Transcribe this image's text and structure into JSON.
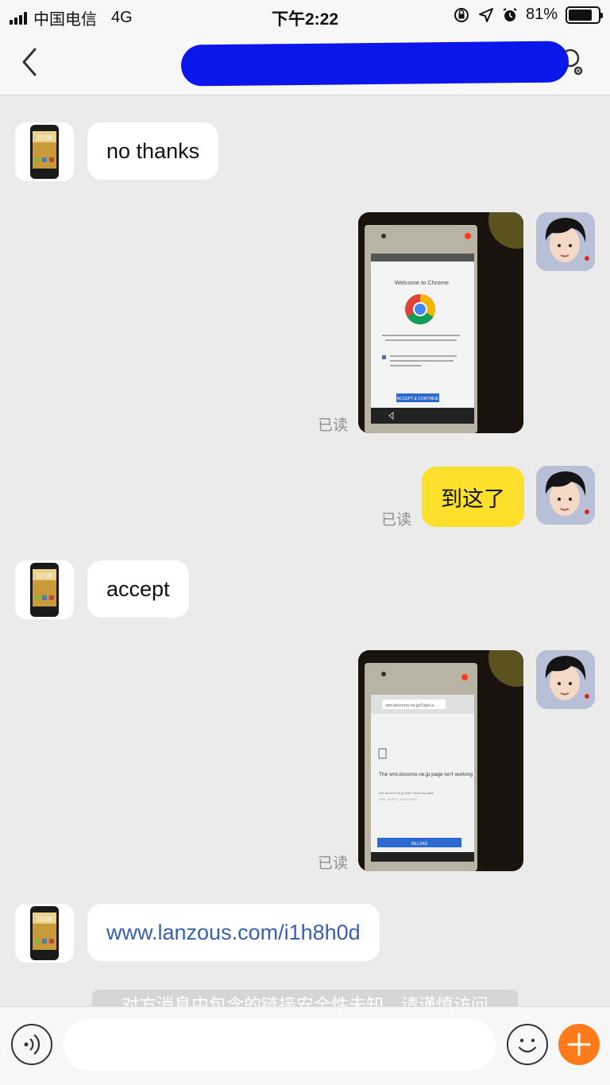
{
  "status_bar": {
    "carrier": "中国电信",
    "network": "4G",
    "time": "下午2:22",
    "battery": "81%",
    "battery_level": 0.81
  },
  "nav": {
    "back_icon": "chevron-left-icon",
    "search_icon": "search-settings-icon"
  },
  "messages": [
    {
      "side": "left",
      "type": "text",
      "text": "no thanks"
    },
    {
      "side": "right",
      "type": "image",
      "status": "已读",
      "image": {
        "screen_title": "Welcome to Chrome",
        "terms_text": "By using this application, you agree to Chrome's Terms of Service and Privacy Notice.",
        "checkbox_text": "Help make Chrome better by sending usage statistics and crash reports to Google.",
        "button": "ACCEPT & CONTINUE"
      }
    },
    {
      "side": "right",
      "type": "text",
      "text": "到这了",
      "status": "已读"
    },
    {
      "side": "left",
      "type": "text",
      "text": "accept"
    },
    {
      "side": "right",
      "type": "image",
      "status": "已读",
      "image": {
        "url_bar": "smt.docomo.ne.jp/Start.a",
        "error_title": "The smt.docomo.ne.jp page isn't working",
        "error_detail": "smt.docomo.ne.jp didn't send any data.",
        "error_code": "ERR_EMPTY_RESPONSE",
        "button": "RELOAD"
      }
    },
    {
      "side": "left",
      "type": "link",
      "text": "www.lanzous.com/i1h8h0d"
    }
  ],
  "notice": "对方消息中包含的链接安全性未知，请谨慎访问",
  "input_bar": {
    "placeholder": "",
    "voice_icon": "voice-icon",
    "emoji_icon": "emoji-icon",
    "plus_icon": "plus-icon"
  },
  "colors": {
    "background": "#ebebeb",
    "own_bubble": "#fde02b",
    "link": "#3760ad",
    "accent": "#ff7b1a",
    "redaction": "#0a16ea"
  }
}
